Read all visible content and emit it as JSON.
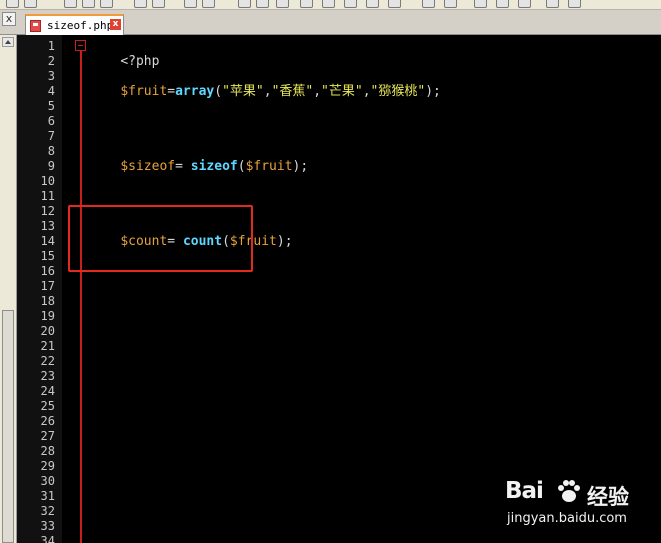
{
  "tab": {
    "filename": "sizeof.php",
    "close_glyph": "x"
  },
  "panel": {
    "close_glyph": "x"
  },
  "editor": {
    "line_numbers": [
      "1",
      "2",
      "3",
      "4",
      "5",
      "6",
      "7",
      "8",
      "9",
      "10",
      "11",
      "12",
      "13",
      "14",
      "15",
      "16",
      "17",
      "18",
      "19",
      "20",
      "21",
      "22",
      "23",
      "24",
      "25",
      "26",
      "27",
      "28",
      "29",
      "30",
      "31",
      "32",
      "33",
      "34"
    ],
    "line1": {
      "text": "<?php"
    },
    "line3": {
      "var": "$fruit",
      "op1": "=",
      "fn": "array",
      "open": "(",
      "s1": "\"苹果\"",
      "c1": ",",
      "s2": "\"香蕉\"",
      "c2": ",",
      "s3": "\"芒果\"",
      "c3": ",",
      "s4": "\"猕猴桃\"",
      "close": ");"
    },
    "line8": {
      "var": "$sizeof",
      "op1": "= ",
      "fn": "sizeof",
      "open": "(",
      "arg": "$fruit",
      "close": ");"
    },
    "line13": {
      "var": "$count",
      "op1": "= ",
      "fn": "count",
      "open": "(",
      "arg": "$fruit",
      "close": ");"
    }
  },
  "watermark": {
    "brand": "Bai",
    "brand_suffix": "经验",
    "url": "jingyan.baidu.com"
  },
  "colors": {
    "editor_bg": "#000000",
    "variable": "#e6a23c",
    "function": "#5fd7ff",
    "string": "#e8e55a",
    "line_number": "#c8c8c8",
    "fold_marker": "#c81e1e",
    "highlight_box": "#e32a1f",
    "tab_accent": "#f39a3a"
  }
}
